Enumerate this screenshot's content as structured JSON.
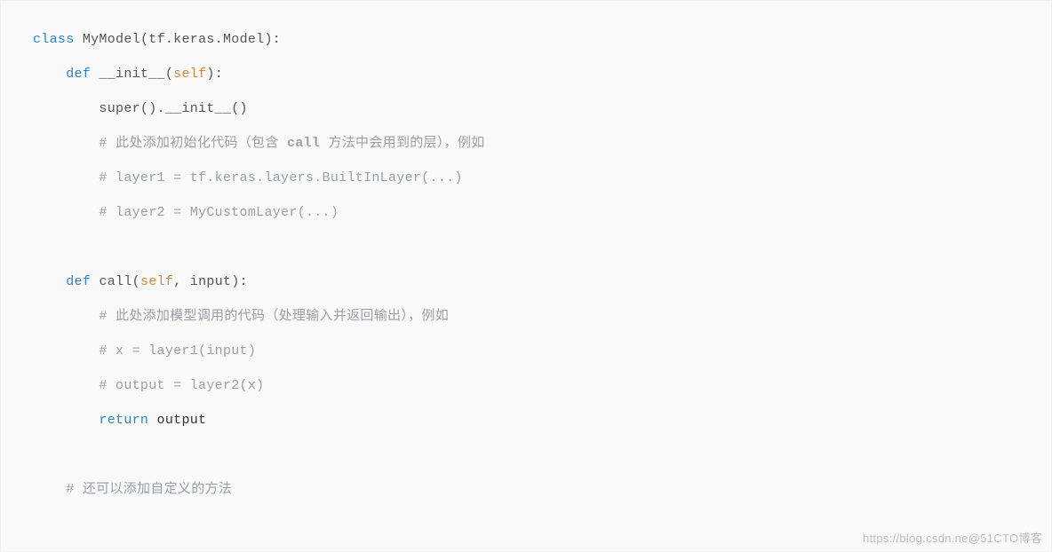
{
  "code": {
    "l1_class": "class",
    "l1_name": "MyModel",
    "l1_paren_open": "(",
    "l1_arg": "tf.keras.Model",
    "l1_paren_close_colon": "):",
    "l2_def": "def",
    "l2_fn": "__init__",
    "l2_paren_open": "(",
    "l2_self": "self",
    "l2_paren_close_colon": "):",
    "l3_text": "super().__init__()",
    "l4_comment_a": "# 此处添加初始化代码（包含 ",
    "l4_comment_strong": "call",
    "l4_comment_b": " 方法中会用到的层），例如",
    "l5_comment": "# layer1 = tf.keras.layers.BuiltInLayer(...)",
    "l6_comment": "# layer2 = MyCustomLayer(...)",
    "l8_def": "def",
    "l8_fn": "call",
    "l8_paren_open": "(",
    "l8_self": "self",
    "l8_comma": ", ",
    "l8_input": "input",
    "l8_paren_close_colon": "):",
    "l9_comment": "# 此处添加模型调用的代码（处理输入并返回输出），例如",
    "l10_comment": "# x = layer1(input)",
    "l11_comment": "# output = layer2(x)",
    "l12_return": "return",
    "l12_space": " ",
    "l12_output": "output",
    "l14_comment": "# 还可以添加自定义的方法"
  },
  "watermark": "https://blog.csdn.ne@51CTO博客"
}
